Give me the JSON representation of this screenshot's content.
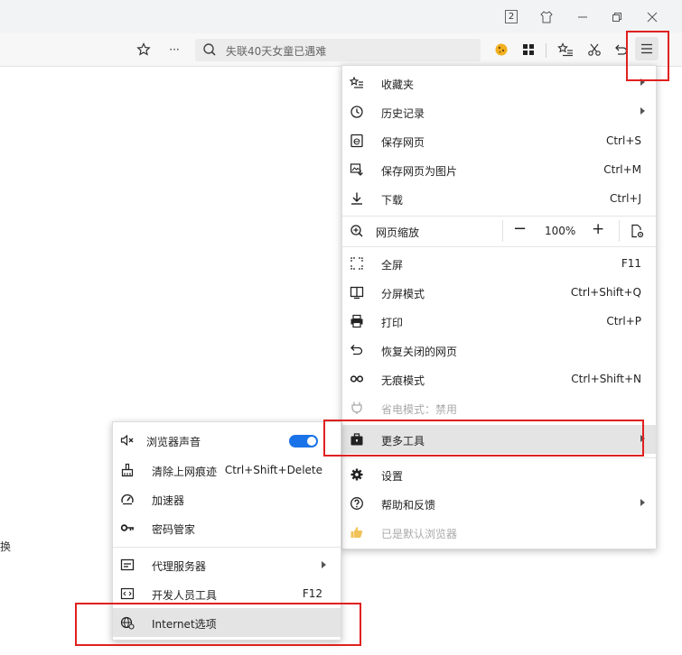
{
  "titlebar": {
    "tab_count": "2",
    "icons": [
      "skin-icon",
      "minimize-icon",
      "restore-icon",
      "close-icon"
    ]
  },
  "toolbar": {
    "more_label": "···",
    "search_text": "失联40天女童已遇难",
    "icons": [
      "star-icon",
      "more-icon",
      "search-icon",
      "extension-icon",
      "apps-icon",
      "favorites-list-icon",
      "scissors-icon",
      "undo-icon",
      "menu-icon"
    ]
  },
  "page": {
    "fragment": "换"
  },
  "menu": {
    "items": [
      {
        "label": "收藏夹",
        "icon": "favorites-icon",
        "shortcut": "",
        "submenu": true
      },
      {
        "label": "历史记录",
        "icon": "history-icon",
        "shortcut": "",
        "submenu": true
      },
      {
        "label": "保存网页",
        "icon": "save-page-icon",
        "shortcut": "Ctrl+S",
        "submenu": false
      },
      {
        "label": "保存网页为图片",
        "icon": "save-image-icon",
        "shortcut": "Ctrl+M",
        "submenu": false
      },
      {
        "label": "下载",
        "icon": "download-icon",
        "shortcut": "Ctrl+J",
        "submenu": false
      }
    ],
    "zoom": {
      "label": "网页缩放",
      "minus": "−",
      "value": "100%",
      "plus": "+"
    },
    "items2": [
      {
        "label": "全屏",
        "icon": "fullscreen-icon",
        "shortcut": "F11",
        "submenu": false
      },
      {
        "label": "分屏模式",
        "icon": "split-screen-icon",
        "shortcut": "Ctrl+Shift+Q",
        "submenu": false
      },
      {
        "label": "打印",
        "icon": "print-icon",
        "shortcut": "Ctrl+P",
        "submenu": false
      },
      {
        "label": "恢复关闭的网页",
        "icon": "restore-tab-icon",
        "shortcut": "",
        "submenu": false
      },
      {
        "label": "无痕模式",
        "icon": "incognito-icon",
        "shortcut": "Ctrl+Shift+N",
        "submenu": false
      },
      {
        "label": "省电模式：禁用",
        "icon": "power-save-icon",
        "shortcut": "",
        "submenu": false,
        "disabled": true
      },
      {
        "label": "更多工具",
        "icon": "toolbox-icon",
        "shortcut": "",
        "submenu": true,
        "highlight": true
      }
    ],
    "items3": [
      {
        "label": "设置",
        "icon": "settings-icon",
        "shortcut": "",
        "submenu": false
      },
      {
        "label": "帮助和反馈",
        "icon": "help-icon",
        "shortcut": "",
        "submenu": true
      },
      {
        "label": "已是默认浏览器",
        "icon": "thumbs-up-icon",
        "shortcut": "",
        "submenu": false,
        "disabled": true
      }
    ]
  },
  "submenu": {
    "items": [
      {
        "label": "浏览器声音",
        "icon": "mute-icon",
        "toggle": true
      },
      {
        "label": "清除上网痕迹",
        "icon": "broom-icon",
        "shortcut": "Ctrl+Shift+Delete"
      },
      {
        "label": "加速器",
        "icon": "speedometer-icon",
        "shortcut": ""
      },
      {
        "label": "密码管家",
        "icon": "key-icon",
        "shortcut": ""
      }
    ],
    "items2": [
      {
        "label": "代理服务器",
        "icon": "proxy-icon",
        "shortcut": "",
        "submenu": true
      },
      {
        "label": "开发人员工具",
        "icon": "dev-tools-icon",
        "shortcut": "F12"
      },
      {
        "label": "Internet选项",
        "icon": "internet-options-icon",
        "shortcut": "",
        "highlight": true
      }
    ]
  },
  "colors": {
    "toggle_on": "#1a73e8",
    "annotation_red": "#e02020",
    "highlight": "#e4e4e4"
  }
}
